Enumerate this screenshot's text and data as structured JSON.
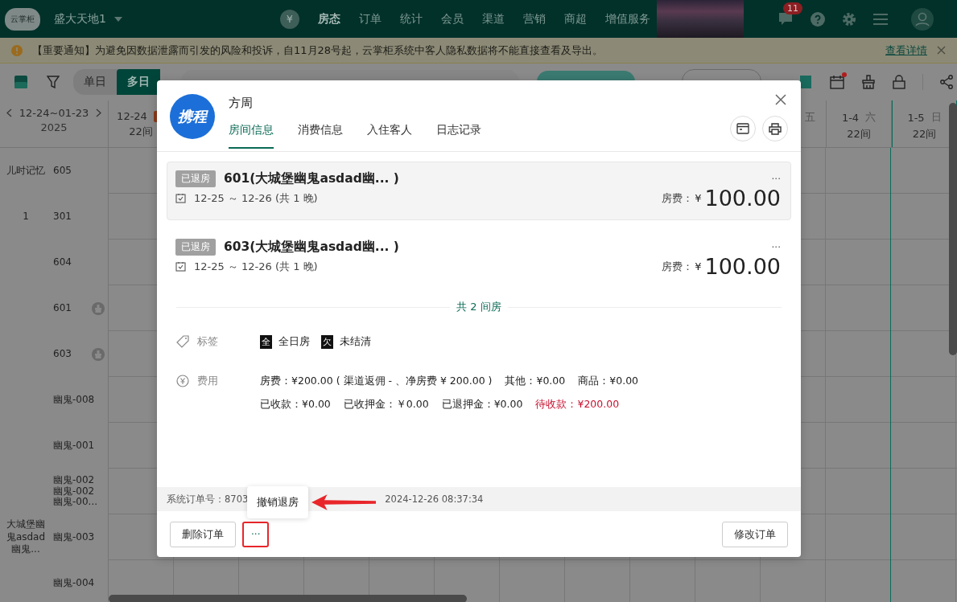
{
  "nav": {
    "logo": "云掌柜",
    "hotel": "盛大天地1",
    "currency_symbol": "¥",
    "menu": [
      {
        "label": "房态",
        "selected": true
      },
      {
        "label": "订单",
        "selected": false
      },
      {
        "label": "统计",
        "selected": false
      },
      {
        "label": "会员",
        "selected": false
      },
      {
        "label": "渠道",
        "selected": false
      },
      {
        "label": "营销",
        "selected": false
      },
      {
        "label": "商超",
        "selected": false
      },
      {
        "label": "增值服务",
        "selected": false
      }
    ],
    "message_count": "11"
  },
  "notice": {
    "text": "【重要通知】为避免因数据泄露而引发的风险和投诉，自11月28号起，云掌柜系统中客人隐私数据将不能直接查看及导出。",
    "link": "查看详情"
  },
  "toolbar": {
    "modes": [
      {
        "label": "单日",
        "selected": false
      },
      {
        "label": "多日",
        "selected": true
      }
    ],
    "calendar_alert": true
  },
  "calendar": {
    "range": "12-24~01-23",
    "year": "2025",
    "days": [
      {
        "date": "12-24",
        "count": "22间",
        "today": false
      },
      {
        "weekday": "五",
        "today": false
      },
      {
        "date": "1-4",
        "weekday": "六",
        "count": "22间",
        "today": false
      },
      {
        "date": "1-5",
        "weekday": "日",
        "count": "22间",
        "today": true
      }
    ],
    "rooms": [
      {
        "group": "儿时记忆",
        "room": "605",
        "cleaning": false
      },
      {
        "group": "1",
        "room": "301",
        "cleaning": false
      },
      {
        "room": "604",
        "cleaning": false
      },
      {
        "room": "601",
        "cleaning": true
      },
      {
        "room": "603",
        "cleaning": true
      },
      {
        "room": "幽鬼-008",
        "cleaning": false
      },
      {
        "room": "幽鬼-001",
        "cleaning": false
      },
      {
        "room": "幽鬼-002\n幽鬼-002\n幽鬼-00...",
        "cleaning": false
      },
      {
        "group": "大城堡幽鬼asdad幽鬼...",
        "room": "幽鬼-003",
        "cleaning": false
      },
      {
        "room": "幽鬼-004",
        "cleaning": false
      }
    ]
  },
  "order": {
    "channel_logo": "携程",
    "guest": "方周",
    "tabs": [
      {
        "label": "房间信息",
        "selected": true
      },
      {
        "label": "消费信息",
        "selected": false
      },
      {
        "label": "入住客人",
        "selected": false
      },
      {
        "label": "日志记录",
        "selected": false
      }
    ],
    "rooms": [
      {
        "status": "已退房",
        "title": "601(大城堡幽鬼asdad幽... )",
        "dates": "12-25 ～ 12-26 (共 1 晚)",
        "fee_label": "房费：",
        "currency": "¥",
        "amount": "100.00",
        "more": "···",
        "selected": true
      },
      {
        "status": "已退房",
        "title": "603(大城堡幽鬼asdad幽... )",
        "dates": "12-25 ～ 12-26 (共 1 晚)",
        "fee_label": "房费：",
        "currency": "¥",
        "amount": "100.00",
        "more": "···",
        "selected": false
      }
    ],
    "room_total": "共 2 间房",
    "tags_label": "标签",
    "tags": [
      {
        "mark": "全",
        "label": "全日房"
      },
      {
        "mark": "欠",
        "label": "未结清"
      }
    ],
    "fees_label": "费用",
    "fee_lines": [
      [
        {
          "text": "房费：¥200.00 ( 渠道返佣 - 、净房费 ¥ 200.00 )",
          "highlight": false
        },
        {
          "text": "其他：¥0.00",
          "highlight": false
        },
        {
          "text": "商品：¥0.00",
          "highlight": false
        }
      ],
      [
        {
          "text": "已收款：¥0.00",
          "highlight": false
        },
        {
          "text": "已收押金：￥0.00",
          "highlight": false
        },
        {
          "text": "已退押金：¥0.00",
          "highlight": false
        },
        {
          "text": "待收款：¥200.00",
          "highlight": true
        }
      ]
    ],
    "order_no": "系统订单号：8703",
    "time": "2024-12-26 08:37:34",
    "delete_button": "删除订单",
    "more_button": "···",
    "edit_button": "修改订单",
    "popup": {
      "items": [
        "撤销退房"
      ]
    }
  }
}
